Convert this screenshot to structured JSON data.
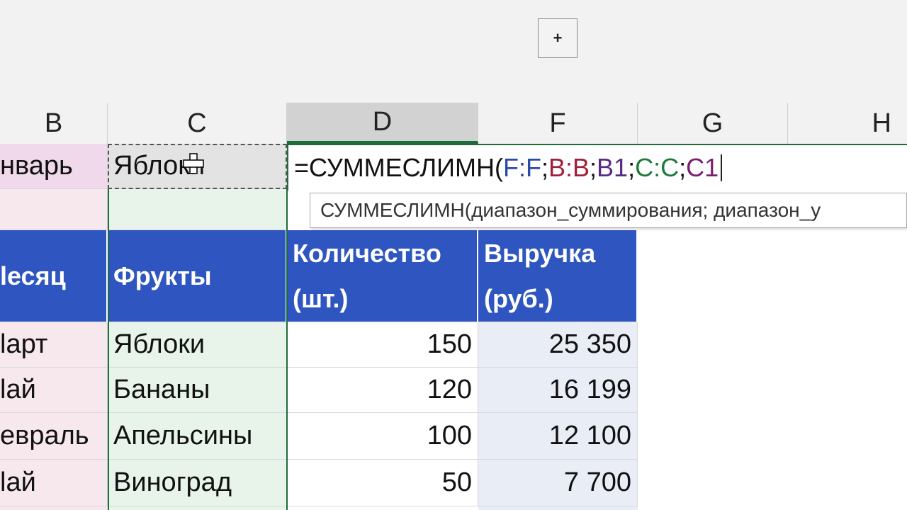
{
  "toolbar": {
    "plus_label": "+"
  },
  "columns": [
    {
      "id": "B",
      "label": "B"
    },
    {
      "id": "C",
      "label": "C"
    },
    {
      "id": "D",
      "label": "D"
    },
    {
      "id": "F",
      "label": "F"
    },
    {
      "id": "G",
      "label": "G"
    },
    {
      "id": "H",
      "label": "H"
    }
  ],
  "row1": {
    "b": "нварь",
    "c": "Яблоки"
  },
  "formula": {
    "text_prefix": "=СУММЕСЛИМН(",
    "arg1": "F:F",
    "sep1": ";",
    "arg2": "B:B",
    "sep2": ";",
    "arg3": "B1",
    "sep3": ";",
    "arg4": "C:C",
    "sep4": ";",
    "arg5": "C1",
    "colors": {
      "arg1": "#2b4aa8",
      "arg2": "#a0203a",
      "arg3": "#5a2a86",
      "arg4": "#1e7a3a",
      "arg5": "#7a1f6e"
    }
  },
  "tooltip": {
    "text": "СУММЕСЛИМН(диапазон_суммирования; диапазон_у"
  },
  "table": {
    "headers": {
      "month": "lесяц",
      "fruit": "Фрукты",
      "qty_line1": "Количество",
      "qty_line2": "(шт.)",
      "rev_line1": "Выручка",
      "rev_line2": "(руб.)"
    },
    "rows": [
      {
        "month": "lарт",
        "fruit": "Яблоки",
        "qty": "150",
        "revenue": "25 350"
      },
      {
        "month": "lай",
        "fruit": "Бананы",
        "qty": "120",
        "revenue": "16 199"
      },
      {
        "month": "евраль",
        "fruit": "Апельсины",
        "qty": "100",
        "revenue": "12 100"
      },
      {
        "month": "lай",
        "fruit": "Виноград",
        "qty": "50",
        "revenue": "7 700"
      }
    ]
  },
  "icons": {
    "cursor": "crosshair-move-cursor-icon"
  }
}
